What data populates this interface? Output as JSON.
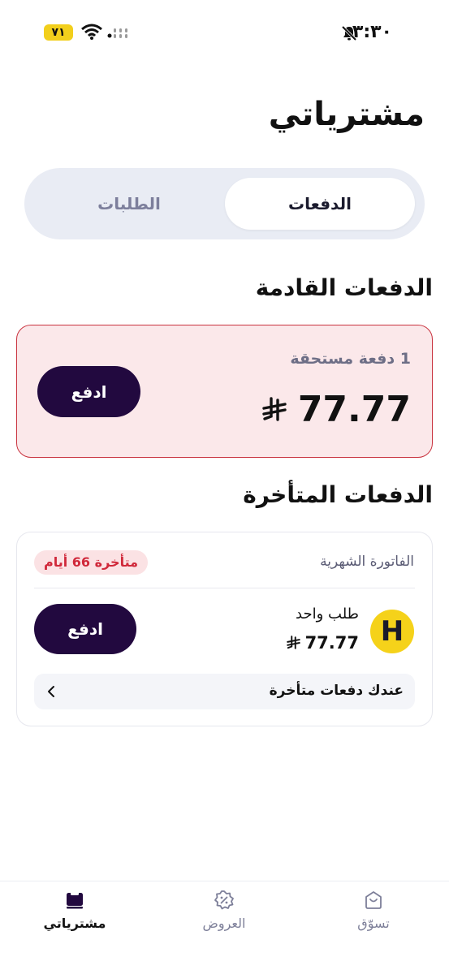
{
  "status_bar": {
    "time": "٣:٣٠",
    "battery": "٧١",
    "icons": [
      "mute-bell-icon",
      "wifi-icon",
      "signal-icon"
    ]
  },
  "page": {
    "title": "مشترياتي"
  },
  "tabs": [
    {
      "label": "الدفعات",
      "active": true
    },
    {
      "label": "الطلبات",
      "active": false
    }
  ],
  "upcoming": {
    "title": "الدفعات القادمة",
    "count_text": "1 دفعة مستحقة",
    "amount": "77.77",
    "currency_icon": "riyal-icon",
    "pay_label": "ادفع"
  },
  "overdue": {
    "title": "الدفعات المتأخرة",
    "bill_label": "الفاتورة الشهرية",
    "late_badge": "متأخرة 66 أيام",
    "merchant_logo_letter": "H",
    "order_name": "طلب واحد",
    "order_amount": "77.77",
    "pay_label": "ادفع",
    "overdue_row_label": "عندك دفعات متأخرة"
  },
  "nav": {
    "purchases": {
      "label": "مشترياتي",
      "icon": "purchases-icon",
      "active": true
    },
    "offers": {
      "label": "العروض",
      "icon": "discount-badge-icon",
      "active": false
    },
    "shop": {
      "label": "تسوّق",
      "icon": "shop-bag-icon",
      "active": false
    }
  },
  "colors": {
    "accent": "#22093f",
    "alert_bg": "#fbe8ea",
    "alert_border": "#c9333f",
    "late_text": "#d0283a",
    "tab_bg": "#e9ecf4",
    "brand_yellow": "#f5d21a"
  }
}
